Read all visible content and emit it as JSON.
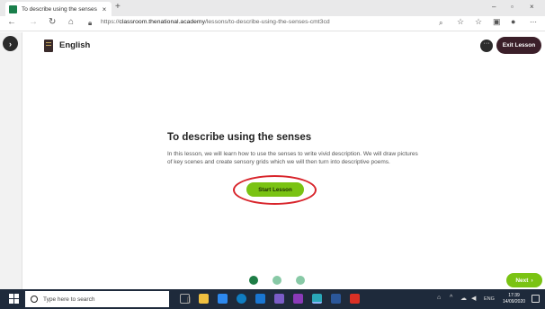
{
  "browser": {
    "tab_title": "To describe using the senses",
    "tab_close": "×",
    "new_tab": "+",
    "url_prefix": "https://",
    "url_host": "classroom.thenational.academy",
    "url_path": "/lessons/to-describe-using-the-senses-cmt3cd",
    "minimize": "–",
    "maximize": "▫",
    "close": "×"
  },
  "rail": {
    "toggle": "›"
  },
  "header": {
    "subject": "English",
    "more": "···",
    "exit_label": "Exit Lesson"
  },
  "lesson": {
    "title": "To describe using the senses",
    "description": "In this lesson, we will learn how to use the senses to write vivid description. We will draw pictures of key scenes and create sensory grids which we will then turn into descriptive poems.",
    "start_label": "Start Lesson"
  },
  "pagination": {
    "pages": 3,
    "current": 1
  },
  "footer": {
    "next_label": "Next",
    "next_arrow": "›"
  },
  "taskbar": {
    "search_placeholder": "Type here to search",
    "lang": "ENG",
    "time": "17:39",
    "date": "14/09/2020"
  },
  "colors": {
    "accent_green": "#7ac313",
    "dark_green": "#1e7d46",
    "exit_purple": "#3b1f29",
    "highlight_red": "#d8242b",
    "taskbar": "#1e2a3b"
  }
}
